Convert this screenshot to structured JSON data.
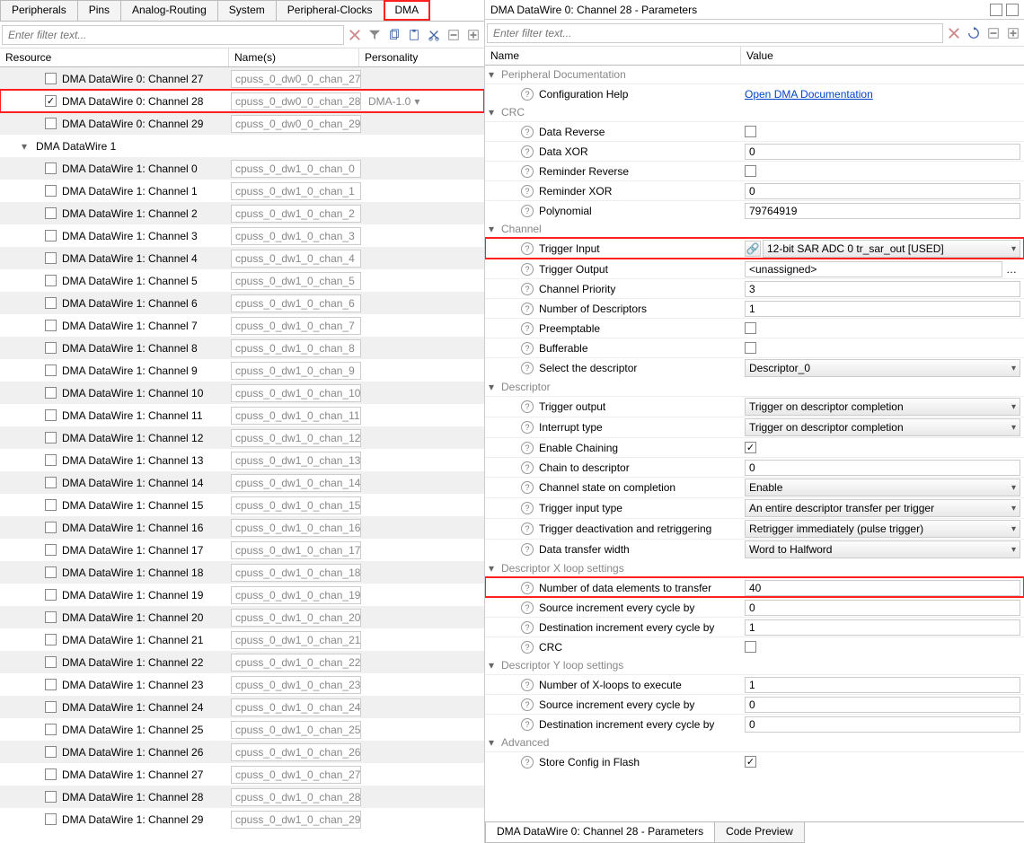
{
  "tabs": [
    "Peripherals",
    "Pins",
    "Analog-Routing",
    "System",
    "Peripheral-Clocks",
    "DMA"
  ],
  "active_tab_index": 5,
  "filter_placeholder": "Enter filter text...",
  "left_headers": {
    "resource": "Resource",
    "name": "Name(s)",
    "personality": "Personality"
  },
  "resources": [
    {
      "level": 2,
      "checked": false,
      "label": "DMA DataWire 0: Channel 27",
      "name": "cpuss_0_dw0_0_chan_27",
      "personality": "",
      "stripe": "even"
    },
    {
      "level": 2,
      "checked": true,
      "label": "DMA DataWire 0: Channel 28",
      "name": "cpuss_0_dw0_0_chan_28",
      "personality": "DMA-1.0",
      "stripe": "odd",
      "highlight": true
    },
    {
      "level": 2,
      "checked": false,
      "label": "DMA DataWire 0: Channel 29",
      "name": "cpuss_0_dw0_0_chan_29",
      "personality": "",
      "stripe": "even"
    },
    {
      "level": 1,
      "group": true,
      "label": "DMA DataWire 1",
      "stripe": "odd"
    },
    {
      "level": 2,
      "checked": false,
      "label": "DMA DataWire 1: Channel 0",
      "name": "cpuss_0_dw1_0_chan_0",
      "personality": "",
      "stripe": "even"
    },
    {
      "level": 2,
      "checked": false,
      "label": "DMA DataWire 1: Channel 1",
      "name": "cpuss_0_dw1_0_chan_1",
      "personality": "",
      "stripe": "odd"
    },
    {
      "level": 2,
      "checked": false,
      "label": "DMA DataWire 1: Channel 2",
      "name": "cpuss_0_dw1_0_chan_2",
      "personality": "",
      "stripe": "even"
    },
    {
      "level": 2,
      "checked": false,
      "label": "DMA DataWire 1: Channel 3",
      "name": "cpuss_0_dw1_0_chan_3",
      "personality": "",
      "stripe": "odd"
    },
    {
      "level": 2,
      "checked": false,
      "label": "DMA DataWire 1: Channel 4",
      "name": "cpuss_0_dw1_0_chan_4",
      "personality": "",
      "stripe": "even"
    },
    {
      "level": 2,
      "checked": false,
      "label": "DMA DataWire 1: Channel 5",
      "name": "cpuss_0_dw1_0_chan_5",
      "personality": "",
      "stripe": "odd"
    },
    {
      "level": 2,
      "checked": false,
      "label": "DMA DataWire 1: Channel 6",
      "name": "cpuss_0_dw1_0_chan_6",
      "personality": "",
      "stripe": "even"
    },
    {
      "level": 2,
      "checked": false,
      "label": "DMA DataWire 1: Channel 7",
      "name": "cpuss_0_dw1_0_chan_7",
      "personality": "",
      "stripe": "odd"
    },
    {
      "level": 2,
      "checked": false,
      "label": "DMA DataWire 1: Channel 8",
      "name": "cpuss_0_dw1_0_chan_8",
      "personality": "",
      "stripe": "even"
    },
    {
      "level": 2,
      "checked": false,
      "label": "DMA DataWire 1: Channel 9",
      "name": "cpuss_0_dw1_0_chan_9",
      "personality": "",
      "stripe": "odd"
    },
    {
      "level": 2,
      "checked": false,
      "label": "DMA DataWire 1: Channel 10",
      "name": "cpuss_0_dw1_0_chan_10",
      "personality": "",
      "stripe": "even"
    },
    {
      "level": 2,
      "checked": false,
      "label": "DMA DataWire 1: Channel 11",
      "name": "cpuss_0_dw1_0_chan_11",
      "personality": "",
      "stripe": "odd"
    },
    {
      "level": 2,
      "checked": false,
      "label": "DMA DataWire 1: Channel 12",
      "name": "cpuss_0_dw1_0_chan_12",
      "personality": "",
      "stripe": "even"
    },
    {
      "level": 2,
      "checked": false,
      "label": "DMA DataWire 1: Channel 13",
      "name": "cpuss_0_dw1_0_chan_13",
      "personality": "",
      "stripe": "odd"
    },
    {
      "level": 2,
      "checked": false,
      "label": "DMA DataWire 1: Channel 14",
      "name": "cpuss_0_dw1_0_chan_14",
      "personality": "",
      "stripe": "even"
    },
    {
      "level": 2,
      "checked": false,
      "label": "DMA DataWire 1: Channel 15",
      "name": "cpuss_0_dw1_0_chan_15",
      "personality": "",
      "stripe": "odd"
    },
    {
      "level": 2,
      "checked": false,
      "label": "DMA DataWire 1: Channel 16",
      "name": "cpuss_0_dw1_0_chan_16",
      "personality": "",
      "stripe": "even"
    },
    {
      "level": 2,
      "checked": false,
      "label": "DMA DataWire 1: Channel 17",
      "name": "cpuss_0_dw1_0_chan_17",
      "personality": "",
      "stripe": "odd"
    },
    {
      "level": 2,
      "checked": false,
      "label": "DMA DataWire 1: Channel 18",
      "name": "cpuss_0_dw1_0_chan_18",
      "personality": "",
      "stripe": "even"
    },
    {
      "level": 2,
      "checked": false,
      "label": "DMA DataWire 1: Channel 19",
      "name": "cpuss_0_dw1_0_chan_19",
      "personality": "",
      "stripe": "odd"
    },
    {
      "level": 2,
      "checked": false,
      "label": "DMA DataWire 1: Channel 20",
      "name": "cpuss_0_dw1_0_chan_20",
      "personality": "",
      "stripe": "even"
    },
    {
      "level": 2,
      "checked": false,
      "label": "DMA DataWire 1: Channel 21",
      "name": "cpuss_0_dw1_0_chan_21",
      "personality": "",
      "stripe": "odd"
    },
    {
      "level": 2,
      "checked": false,
      "label": "DMA DataWire 1: Channel 22",
      "name": "cpuss_0_dw1_0_chan_22",
      "personality": "",
      "stripe": "even"
    },
    {
      "level": 2,
      "checked": false,
      "label": "DMA DataWire 1: Channel 23",
      "name": "cpuss_0_dw1_0_chan_23",
      "personality": "",
      "stripe": "odd"
    },
    {
      "level": 2,
      "checked": false,
      "label": "DMA DataWire 1: Channel 24",
      "name": "cpuss_0_dw1_0_chan_24",
      "personality": "",
      "stripe": "even"
    },
    {
      "level": 2,
      "checked": false,
      "label": "DMA DataWire 1: Channel 25",
      "name": "cpuss_0_dw1_0_chan_25",
      "personality": "",
      "stripe": "odd"
    },
    {
      "level": 2,
      "checked": false,
      "label": "DMA DataWire 1: Channel 26",
      "name": "cpuss_0_dw1_0_chan_26",
      "personality": "",
      "stripe": "even"
    },
    {
      "level": 2,
      "checked": false,
      "label": "DMA DataWire 1: Channel 27",
      "name": "cpuss_0_dw1_0_chan_27",
      "personality": "",
      "stripe": "odd"
    },
    {
      "level": 2,
      "checked": false,
      "label": "DMA DataWire 1: Channel 28",
      "name": "cpuss_0_dw1_0_chan_28",
      "personality": "",
      "stripe": "even"
    },
    {
      "level": 2,
      "checked": false,
      "label": "DMA DataWire 1: Channel 29",
      "name": "cpuss_0_dw1_0_chan_29",
      "personality": "",
      "stripe": "odd"
    }
  ],
  "right_title": "DMA DataWire 0: Channel 28 - Parameters",
  "right_filter_placeholder": "Enter filter text...",
  "param_headers": {
    "name": "Name",
    "value": "Value"
  },
  "params": [
    {
      "kind": "group",
      "label": "Peripheral Documentation"
    },
    {
      "kind": "param",
      "label": "Configuration Help",
      "type": "link",
      "value": "Open DMA Documentation"
    },
    {
      "kind": "group",
      "label": "CRC"
    },
    {
      "kind": "param",
      "label": "Data Reverse",
      "type": "checkbox",
      "checked": false
    },
    {
      "kind": "param",
      "label": "Data XOR",
      "type": "text",
      "value": "0"
    },
    {
      "kind": "param",
      "label": "Reminder Reverse",
      "type": "checkbox",
      "checked": false
    },
    {
      "kind": "param",
      "label": "Reminder XOR",
      "type": "text",
      "value": "0"
    },
    {
      "kind": "param",
      "label": "Polynomial",
      "type": "text",
      "value": "79764919"
    },
    {
      "kind": "group",
      "label": "Channel"
    },
    {
      "kind": "param",
      "label": "Trigger Input",
      "type": "link-dropdown",
      "value": "12-bit SAR ADC 0 tr_sar_out [USED]",
      "highlight": true
    },
    {
      "kind": "param",
      "label": "Trigger Output",
      "type": "ellipsis",
      "value": "<unassigned>"
    },
    {
      "kind": "param",
      "label": "Channel Priority",
      "type": "text",
      "value": "3"
    },
    {
      "kind": "param",
      "label": "Number of Descriptors",
      "type": "text",
      "value": "1"
    },
    {
      "kind": "param",
      "label": "Preemptable",
      "type": "checkbox",
      "checked": false
    },
    {
      "kind": "param",
      "label": "Bufferable",
      "type": "checkbox",
      "checked": false
    },
    {
      "kind": "param",
      "label": "Select the descriptor",
      "type": "dropdown",
      "value": "Descriptor_0"
    },
    {
      "kind": "group",
      "label": "Descriptor"
    },
    {
      "kind": "param",
      "label": "Trigger output",
      "type": "dropdown",
      "value": "Trigger on descriptor completion"
    },
    {
      "kind": "param",
      "label": "Interrupt type",
      "type": "dropdown",
      "value": "Trigger on descriptor completion"
    },
    {
      "kind": "param",
      "label": "Enable Chaining",
      "type": "checkbox",
      "checked": true
    },
    {
      "kind": "param",
      "label": "Chain to descriptor",
      "type": "text",
      "value": "0"
    },
    {
      "kind": "param",
      "label": "Channel state on completion",
      "type": "dropdown",
      "value": "Enable"
    },
    {
      "kind": "param",
      "label": "Trigger input type",
      "type": "dropdown",
      "value": "An entire descriptor transfer per trigger"
    },
    {
      "kind": "param",
      "label": "Trigger deactivation and retriggering",
      "type": "dropdown",
      "value": "Retrigger immediately (pulse trigger)"
    },
    {
      "kind": "param",
      "label": "Data transfer width",
      "type": "dropdown",
      "value": "Word to Halfword"
    },
    {
      "kind": "group",
      "label": "Descriptor X loop settings"
    },
    {
      "kind": "param",
      "label": "Number of data elements to transfer",
      "type": "text",
      "value": "40",
      "highlight": true
    },
    {
      "kind": "param",
      "label": "Source increment every cycle by",
      "type": "text",
      "value": "0"
    },
    {
      "kind": "param",
      "label": "Destination increment every cycle by",
      "type": "text",
      "value": "1"
    },
    {
      "kind": "param",
      "label": "CRC",
      "type": "checkbox",
      "checked": false
    },
    {
      "kind": "group",
      "label": "Descriptor Y loop settings"
    },
    {
      "kind": "param",
      "label": "Number of X-loops to execute",
      "type": "text",
      "value": "1"
    },
    {
      "kind": "param",
      "label": "Source increment every cycle by",
      "type": "text",
      "value": "0"
    },
    {
      "kind": "param",
      "label": "Destination increment every cycle by",
      "type": "text",
      "value": "0"
    },
    {
      "kind": "group",
      "label": "Advanced"
    },
    {
      "kind": "param",
      "label": "Store Config in Flash",
      "type": "checkbox",
      "checked": true
    }
  ],
  "bottom_tabs": [
    "DMA DataWire 0: Channel 28 - Parameters",
    "Code Preview"
  ],
  "bottom_active_index": 0
}
